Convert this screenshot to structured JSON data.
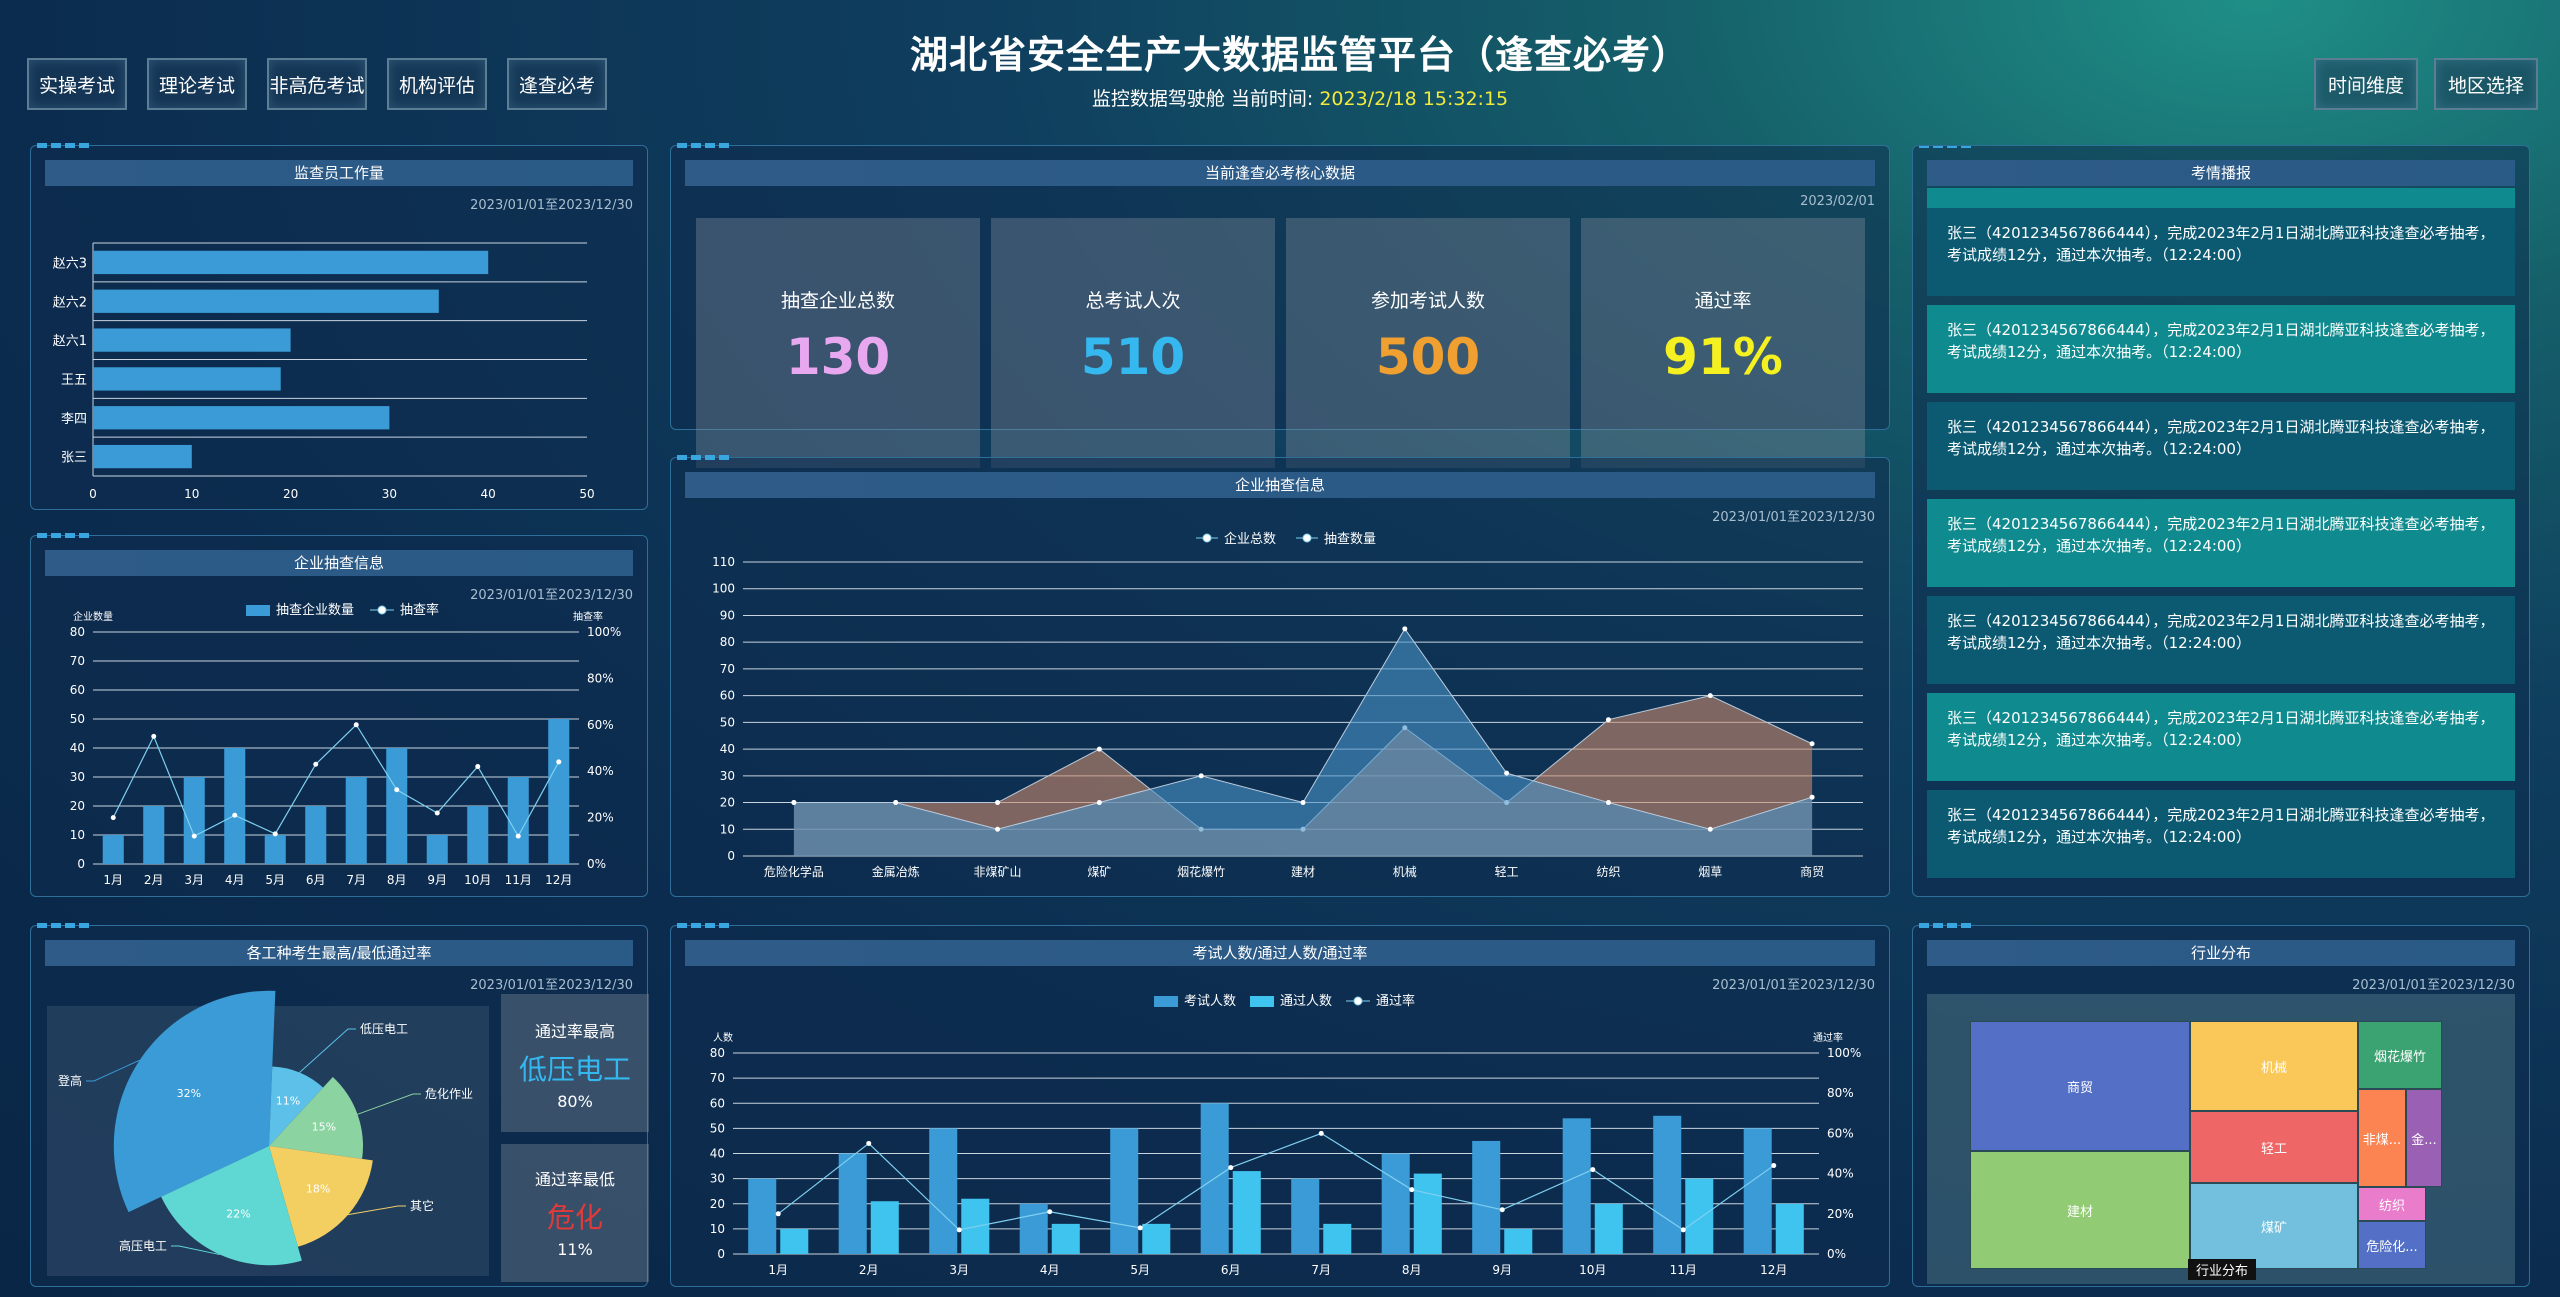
{
  "header": {
    "title": "湖北省安全生产大数据监管平台（逢查必考）",
    "subtitle_prefix": "监控数据驾驶舱 当前时间: ",
    "current_time": "2023/2/18 15:32:15",
    "nav_left": [
      "实操考试",
      "理论考试",
      "非高危考试",
      "机构评估",
      "逢查必考"
    ],
    "nav_right": [
      "时间维度",
      "地区选择"
    ]
  },
  "supervisor_workload": {
    "title": "监查员工作量",
    "date_range": "2023/01/01至2023/12/30",
    "chart_data": {
      "type": "bar",
      "orientation": "horizontal",
      "categories": [
        "赵六3",
        "赵六2",
        "赵六1",
        "王五",
        "李四",
        "张三"
      ],
      "values": [
        40,
        35,
        20,
        19,
        30,
        10
      ],
      "xlim": [
        0,
        50
      ],
      "x_ticks": [
        "0",
        "10",
        "20",
        "30",
        "40",
        "50"
      ]
    }
  },
  "enterprise_check": {
    "title": "企业抽查信息",
    "date_range": "2023/01/01至2023/12/30",
    "chart_data": {
      "type": "bar",
      "categories": [
        "1月",
        "2月",
        "3月",
        "4月",
        "5月",
        "6月",
        "7月",
        "8月",
        "9月",
        "10月",
        "11月",
        "12月"
      ],
      "series": [
        {
          "name": "抽查企业数量",
          "type": "bar",
          "values": [
            10,
            20,
            30,
            40,
            10,
            20,
            30,
            40,
            10,
            20,
            30,
            50
          ]
        },
        {
          "name": "抽查率",
          "type": "line",
          "axis": "right",
          "values": [
            20,
            55,
            12,
            21,
            13,
            43,
            60,
            32,
            22,
            42,
            12,
            44
          ]
        }
      ],
      "ylabel_left": "企业数量",
      "ylabel_right": "抽查率",
      "ylim": [
        0,
        80
      ],
      "y_ticks": [
        "0",
        "10",
        "20",
        "30",
        "40",
        "50",
        "60",
        "70",
        "80"
      ],
      "y2_ticks": [
        "0%",
        "20%",
        "40%",
        "60%",
        "80%",
        "100%"
      ]
    }
  },
  "pass_rate_by_type": {
    "title": "各工种考生最高/最低通过率",
    "date_range": "2023/01/01至2023/12/30",
    "chart_data": {
      "type": "pie",
      "slices": [
        {
          "label": "登高",
          "value": 32,
          "text": "32%",
          "color": "#3a9bd6"
        },
        {
          "label": "低压电工",
          "value": 11,
          "text": "11%",
          "color": "#5cc0e8"
        },
        {
          "label": "危化作业",
          "value": 15,
          "text": "15%",
          "color": "#8bd3a0"
        },
        {
          "label": "其它",
          "value": 18,
          "text": "18%",
          "color": "#f3cf62"
        },
        {
          "label": "高压电工",
          "value": 22,
          "text": "22%",
          "color": "#5fd7d3"
        }
      ]
    },
    "highest": {
      "label": "通过率最高",
      "name": "低压电工",
      "rate": "80%"
    },
    "lowest": {
      "label": "通过率最低",
      "name": "危化",
      "rate": "11%"
    }
  },
  "core_data": {
    "title": "当前逢查必考核心数据",
    "date": "2023/02/01",
    "kpis": [
      {
        "label": "抽查企业总数",
        "value": "130",
        "color": "#e8a8f0"
      },
      {
        "label": "总考试人次",
        "value": "510",
        "color": "#35b8ef"
      },
      {
        "label": "参加考试人数",
        "value": "500",
        "color": "#f0a030"
      },
      {
        "label": "通过率",
        "value": "91%",
        "color": "#f5f020"
      }
    ]
  },
  "enterprise_area": {
    "title": "企业抽查信息",
    "date_range": "2023/01/01至2023/12/30",
    "chart_data": {
      "type": "area",
      "categories": [
        "危险化学品",
        "金属冶炼",
        "非煤矿山",
        "煤矿",
        "烟花爆竹",
        "建材",
        "机械",
        "轻工",
        "纺织",
        "烟草",
        "商贸"
      ],
      "series": [
        {
          "name": "企业总数",
          "values": [
            20,
            20,
            20,
            40,
            10,
            10,
            48,
            20,
            51,
            60,
            42
          ],
          "color": "#c98a6c"
        },
        {
          "name": "抽查数量",
          "values": [
            20,
            20,
            10,
            20,
            30,
            20,
            85,
            31,
            20,
            10,
            22
          ],
          "color": "#4a93c8"
        }
      ],
      "ylim": [
        0,
        110
      ],
      "y_ticks": [
        "0",
        "10",
        "20",
        "30",
        "40",
        "50",
        "60",
        "70",
        "80",
        "90",
        "100",
        "110"
      ]
    }
  },
  "exam_stats": {
    "title": "考试人数/通过人数/通过率",
    "date_range": "2023/01/01至2023/12/30",
    "chart_data": {
      "type": "bar",
      "categories": [
        "1月",
        "2月",
        "3月",
        "4月",
        "5月",
        "6月",
        "7月",
        "8月",
        "9月",
        "10月",
        "11月",
        "12月"
      ],
      "series": [
        {
          "name": "考试人数",
          "type": "bar",
          "values": [
            30,
            40,
            50,
            20,
            50,
            60,
            30,
            40,
            45,
            54,
            55,
            50
          ]
        },
        {
          "name": "通过人数",
          "type": "bar",
          "values": [
            10,
            21,
            22,
            12,
            12,
            33,
            12,
            32,
            10,
            20,
            30,
            20
          ]
        },
        {
          "name": "通过率",
          "type": "line",
          "axis": "right",
          "values": [
            20,
            55,
            12,
            21,
            13,
            43,
            60,
            32,
            22,
            42,
            12,
            44
          ]
        }
      ],
      "ylabel_left": "人数",
      "ylabel_right": "通过率",
      "ylim": [
        0,
        80
      ],
      "y_ticks": [
        "0",
        "10",
        "20",
        "30",
        "40",
        "50",
        "60",
        "70",
        "80"
      ],
      "y2_ticks": [
        "0%",
        "20%",
        "40%",
        "60%",
        "80%",
        "100%"
      ]
    }
  },
  "exam_alerts": {
    "title": "考情播报",
    "messages": [
      "张三（4201234567866444），完成2023年2月1日湖北腾亚科技逢查必考抽考，考试成绩12分，通过本次抽考。（12:24:00）",
      "张三（4201234567866444），完成2023年2月1日湖北腾亚科技逢查必考抽考，考试成绩12分，通过本次抽考。（12:24:00）",
      "张三（4201234567866444），完成2023年2月1日湖北腾亚科技逢查必考抽考，考试成绩12分，通过本次抽考。（12:24:00）",
      "张三（4201234567866444），完成2023年2月1日湖北腾亚科技逢查必考抽考，考试成绩12分，通过本次抽考。（12:24:00）",
      "张三（4201234567866444），完成2023年2月1日湖北腾亚科技逢查必考抽考，考试成绩12分，通过本次抽考。（12:24:00）",
      "张三（4201234567866444），完成2023年2月1日湖北腾亚科技逢查必考抽考，考试成绩12分，通过本次抽考。（12:24:00）",
      "张三（4201234567866444），完成2023年2月1日湖北腾亚科技逢查必考抽考，考试成绩12分，通过本次抽考。（12:24:00）"
    ]
  },
  "industry": {
    "title": "行业分布",
    "date_range": "2023/01/01至2023/12/30",
    "footer_label": "行业分布",
    "chart_data": {
      "type": "treemap",
      "items": [
        {
          "label": "商贸",
          "color": "#5470c6"
        },
        {
          "label": "建材",
          "color": "#91cc75"
        },
        {
          "label": "机械",
          "color": "#fac858"
        },
        {
          "label": "轻工",
          "color": "#ee6666"
        },
        {
          "label": "煤矿",
          "color": "#73c0de"
        },
        {
          "label": "烟花爆竹",
          "color": "#3ba272"
        },
        {
          "label": "非煤...",
          "color": "#fc8452"
        },
        {
          "label": "金...",
          "color": "#9a60b4"
        },
        {
          "label": "纺织",
          "color": "#ea7ccc"
        },
        {
          "label": "危险化...",
          "color": "#5470c6"
        }
      ]
    }
  }
}
